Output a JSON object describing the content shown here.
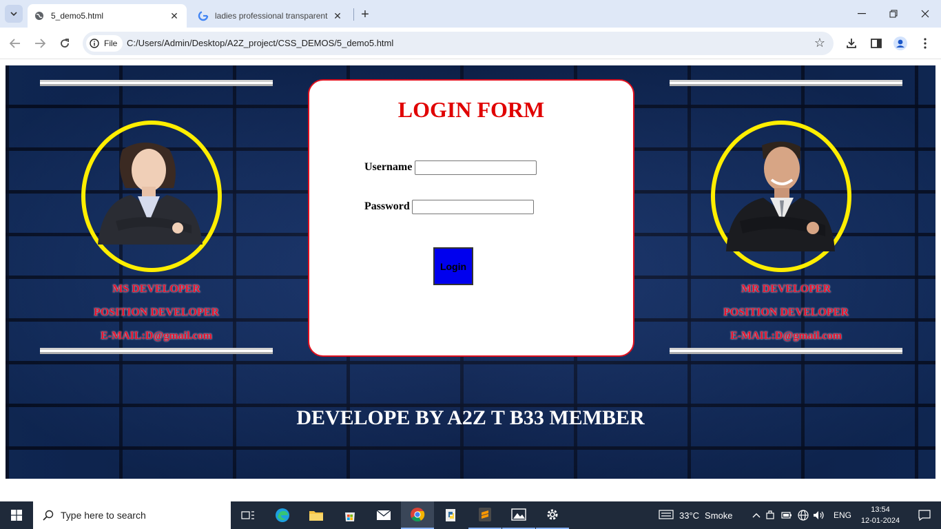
{
  "browser": {
    "tabs": [
      {
        "title": "5_demo5.html",
        "active": true
      },
      {
        "title": "ladies professional transparent",
        "active": false
      }
    ],
    "address": {
      "scheme_label": "File",
      "url": "C:/Users/Admin/Desktop/A2Z_project/CSS_DEMOS/5_demo5.html"
    }
  },
  "page": {
    "left_profile": {
      "name": "MS DEVELOPER",
      "position": "POSITION DEVELOPER",
      "email": "E-MAIL:D@gmail.com"
    },
    "right_profile": {
      "name": "MR DEVELOPER",
      "position": "POSITION DEVELOPER",
      "email": "E-MAIL:D@gmail.com"
    },
    "form": {
      "title": "LOGIN FORM",
      "username_label": "Username",
      "username_value": "",
      "password_label": "Password",
      "password_value": "",
      "login_label": "Login"
    },
    "footer": "DEVELOPE BY A2Z T B33 MEMBER"
  },
  "taskbar": {
    "search_placeholder": "Type here to search",
    "weather": {
      "temp": "33°C",
      "condition": "Smoke"
    },
    "language": "ENG",
    "time": "13:54",
    "date": "12-01-2024"
  },
  "colors": {
    "accent_red": "#e00000",
    "ring_yellow": "#ffee00",
    "button_blue": "#0000ee",
    "page_bg": "#14306a"
  }
}
